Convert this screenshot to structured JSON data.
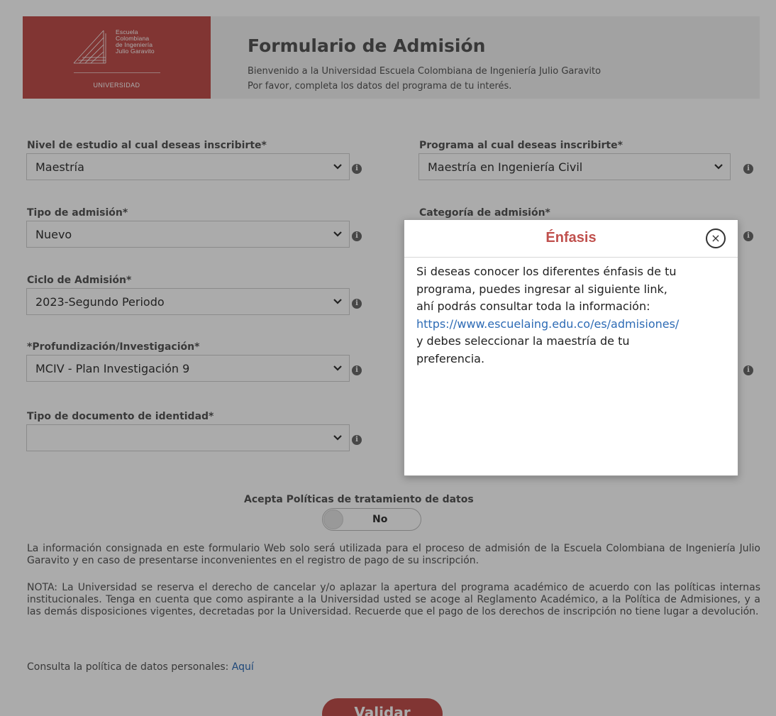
{
  "header": {
    "logo": {
      "lines": [
        "Escuela",
        "Colombiana",
        "de Ingeniería",
        "Julio Garavito"
      ],
      "subtitle": "UNIVERSIDAD"
    },
    "title": "Formulario de Admisión",
    "line1": "Bienvenido a la Universidad Escuela Colombiana de Ingeniería Julio Garavito",
    "line2": "Por favor, completa los datos del programa de tu interés."
  },
  "form": {
    "nivel": {
      "label": "Nivel de estudio al cual deseas inscribirte*",
      "value": "Maestría"
    },
    "programa": {
      "label": "Programa al cual deseas inscribirte*",
      "value": "Maestría en Ingeniería Civil"
    },
    "tipo_admision": {
      "label": "Tipo de admisión*",
      "value": "Nuevo"
    },
    "categoria": {
      "label": "Categoría de admisión*",
      "value": ""
    },
    "ciclo": {
      "label": "Ciclo de Admisión*",
      "value": "2023-Segundo Periodo"
    },
    "profundizacion": {
      "label": "*Profundización/Investigación*",
      "value": "MCIV - Plan Investigación 9"
    },
    "tipo_documento": {
      "label": "Tipo de documento de identidad*",
      "value": ""
    },
    "info_icon": "i"
  },
  "policies": {
    "toggle_label": "Acepta Políticas de tratamiento de datos",
    "toggle_value": "No"
  },
  "notes": {
    "p1": "La información consignada en este formulario Web solo será utilizada para el proceso de admisión de la Escuela Colombiana de Ingeniería Julio Garavito y en caso de presentarse inconvenientes en el registro de pago de su inscripción.",
    "p2": "NOTA: La Universidad se reserva el derecho de cancelar y/o aplazar la apertura del programa académico de acuerdo con las políticas internas institucionales. Tenga en cuenta que como aspirante a la Universidad usted se acoge al Reglamento Académico, a la Política de Admisiones, y a las demás disposiciones vigentes, decretadas por la Universidad. Recuerde que el pago de los derechos de inscripción no tiene lugar a devolución.",
    "p3_prefix": "Consulta la política de datos personales: ",
    "p3_link": "Aquí"
  },
  "submit_label": "Validar",
  "modal": {
    "title": "Énfasis",
    "close_glyph": "×",
    "line1": "Si deseas conocer los diferentes énfasis de tu",
    "line2": "programa, puedes ingresar al siguiente link,",
    "line3": "ahí podrás consultar toda la información:",
    "link": "https://www.escuelaing.edu.co/es/admisiones/",
    "line4": "y debes seleccionar la maestría de tu",
    "line5": "preferencia."
  },
  "colors": {
    "brand": "#c0504d",
    "link": "#2d6bb5",
    "overlay": "rgba(0,0,0,0.33)"
  },
  "icons": [
    "chevron-down-icon",
    "info-icon",
    "close-icon",
    "logo-emblem"
  ]
}
